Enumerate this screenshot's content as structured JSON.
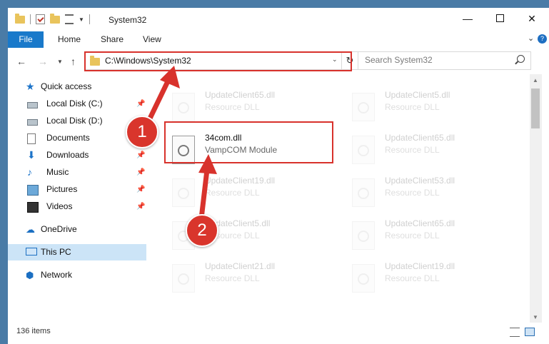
{
  "window": {
    "title": "System32",
    "controls": {
      "minimize": "—",
      "maximize": "",
      "close": "✕"
    }
  },
  "ribbon": {
    "tabs": [
      "File",
      "Home",
      "Share",
      "View"
    ]
  },
  "address": {
    "path": "C:\\Windows\\System32",
    "search_placeholder": "Search System32"
  },
  "sidebar": {
    "items": [
      {
        "label": "Quick access",
        "icon": "star-icon",
        "pinned": false
      },
      {
        "label": "Local Disk (C:)",
        "icon": "drive-icon",
        "pinned": true
      },
      {
        "label": "Local Disk (D:)",
        "icon": "drive-icon",
        "pinned": false
      },
      {
        "label": "Documents",
        "icon": "documents-icon",
        "pinned": true
      },
      {
        "label": "Downloads",
        "icon": "downloads-icon",
        "pinned": true
      },
      {
        "label": "Music",
        "icon": "music-icon",
        "pinned": true
      },
      {
        "label": "Pictures",
        "icon": "pictures-icon",
        "pinned": true
      },
      {
        "label": "Videos",
        "icon": "videos-icon",
        "pinned": true
      },
      {
        "label": "OneDrive",
        "icon": "onedrive-icon",
        "pinned": false
      },
      {
        "label": "This PC",
        "icon": "this-pc-icon",
        "pinned": false,
        "selected": true
      },
      {
        "label": "Network",
        "icon": "network-icon",
        "pinned": false
      }
    ]
  },
  "files": {
    "left": [
      {
        "name": "UpdateClient65.dll",
        "desc": "Resource DLL"
      },
      {
        "name": "34com.dll",
        "desc": "VampCOM Module",
        "highlighted": true
      },
      {
        "name": "UpdateClient19.dll",
        "desc": "Resource DLL"
      },
      {
        "name": "UpdateClient5.dll",
        "desc": "Resource DLL"
      },
      {
        "name": "UpdateClient21.dll",
        "desc": "Resource DLL"
      }
    ],
    "right": [
      {
        "name": "UpdateClient5.dll",
        "desc": "Resource DLL"
      },
      {
        "name": "UpdateClient65.dll",
        "desc": "Resource DLL"
      },
      {
        "name": "UpdateClient53.dll",
        "desc": "Resource DLL"
      },
      {
        "name": "UpdateClient65.dll",
        "desc": "Resource DLL"
      },
      {
        "name": "UpdateClient19.dll",
        "desc": "Resource DLL"
      }
    ]
  },
  "status": {
    "item_count": "136 items"
  },
  "annotations": {
    "step1": "1",
    "step2": "2",
    "color": "#d8322c"
  }
}
